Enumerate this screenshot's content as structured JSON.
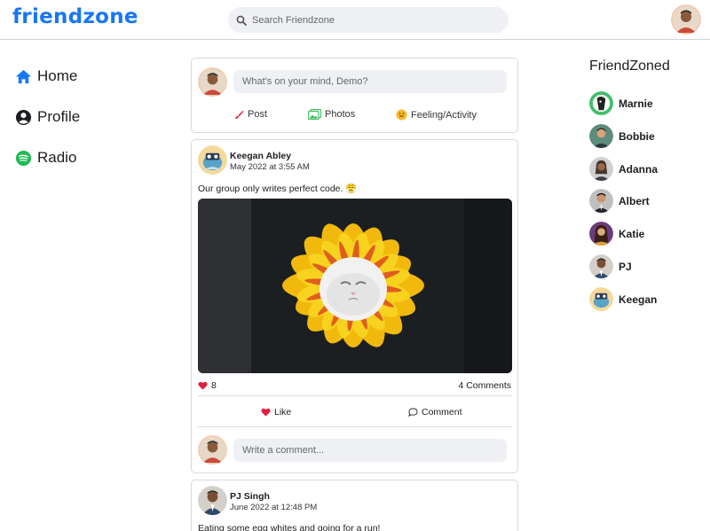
{
  "header": {
    "logo": "friendzone",
    "search_placeholder": "Search Friendzone"
  },
  "nav": {
    "items": [
      {
        "label": "Home",
        "icon": "home-icon"
      },
      {
        "label": "Profile",
        "icon": "user-circle-icon"
      },
      {
        "label": "Radio",
        "icon": "spotify-icon"
      }
    ]
  },
  "composer": {
    "placeholder": "What's on your mind, Demo?",
    "actions": [
      {
        "label": "Post",
        "icon": "brush-icon"
      },
      {
        "label": "Photos",
        "icon": "photos-icon"
      },
      {
        "label": "Feeling/Activity",
        "icon": "smile-icon"
      }
    ]
  },
  "posts": [
    {
      "author": "Keegan Abley",
      "time": "May 2022 at 3:55 AM",
      "text": "Our group only writes perfect code. 😤",
      "image": "cat-in-sunflower-costume",
      "likes": "8",
      "comments": "4 Comments",
      "like_label": "Like",
      "comment_label": "Comment",
      "comment_placeholder": "Write a comment..."
    },
    {
      "author": "PJ Singh",
      "time": "June 2022 at 12:48 PM",
      "text": "Eating some egg whites and going for a run!"
    }
  ],
  "friends": {
    "title": "FriendZoned",
    "list": [
      {
        "name": "Marnie"
      },
      {
        "name": "Bobbie"
      },
      {
        "name": "Adanna"
      },
      {
        "name": "Albert"
      },
      {
        "name": "Katie"
      },
      {
        "name": "PJ"
      },
      {
        "name": "Keegan"
      }
    ]
  },
  "colors": {
    "brand": "#1877f2",
    "like_red": "#e41e3f",
    "spotify_green": "#1db954"
  }
}
